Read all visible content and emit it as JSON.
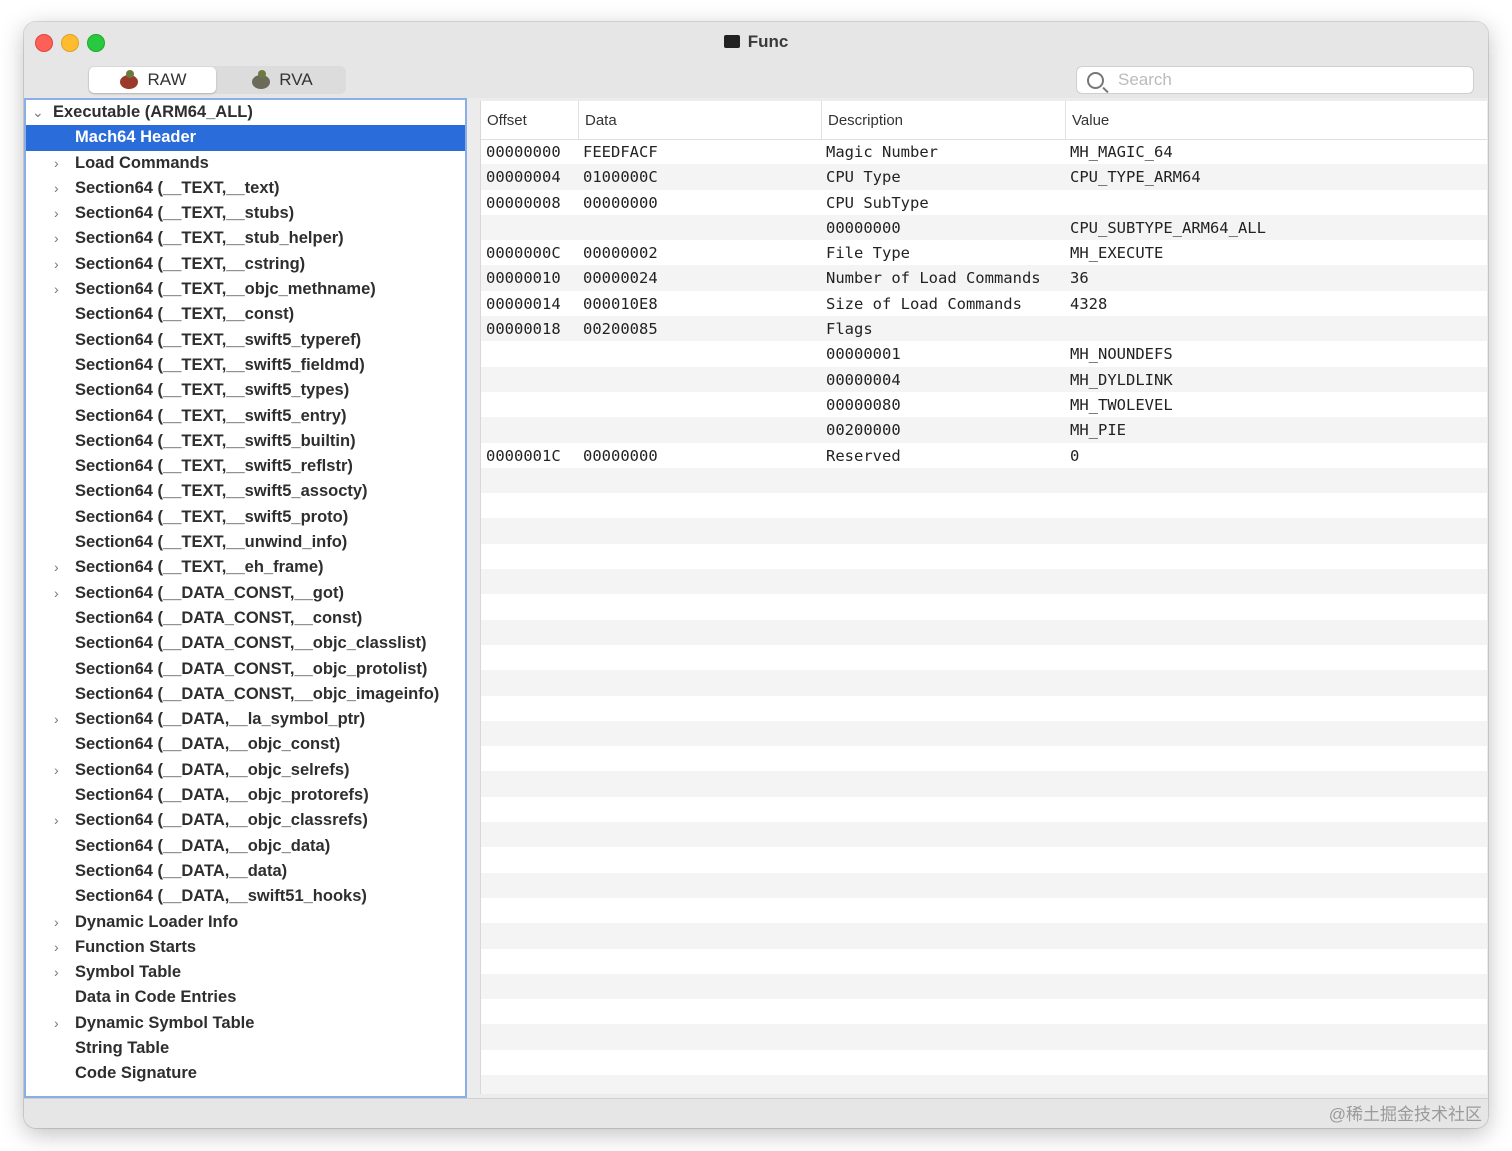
{
  "window": {
    "title": "Func"
  },
  "toolbar": {
    "segments": [
      {
        "label": "RAW",
        "active": true
      },
      {
        "label": "RVA",
        "active": false
      }
    ],
    "search_placeholder": "Search"
  },
  "sidebar": {
    "root": "Executable  (ARM64_ALL)",
    "items": [
      {
        "label": "Mach64 Header",
        "expandable": false,
        "selected": true
      },
      {
        "label": "Load Commands",
        "expandable": true
      },
      {
        "label": "Section64 (__TEXT,__text)",
        "expandable": true
      },
      {
        "label": "Section64 (__TEXT,__stubs)",
        "expandable": true
      },
      {
        "label": "Section64 (__TEXT,__stub_helper)",
        "expandable": true
      },
      {
        "label": "Section64 (__TEXT,__cstring)",
        "expandable": true
      },
      {
        "label": "Section64 (__TEXT,__objc_methname)",
        "expandable": true
      },
      {
        "label": "Section64 (__TEXT,__const)",
        "expandable": false
      },
      {
        "label": "Section64 (__TEXT,__swift5_typeref)",
        "expandable": false
      },
      {
        "label": "Section64 (__TEXT,__swift5_fieldmd)",
        "expandable": false
      },
      {
        "label": "Section64 (__TEXT,__swift5_types)",
        "expandable": false
      },
      {
        "label": "Section64 (__TEXT,__swift5_entry)",
        "expandable": false
      },
      {
        "label": "Section64 (__TEXT,__swift5_builtin)",
        "expandable": false
      },
      {
        "label": "Section64 (__TEXT,__swift5_reflstr)",
        "expandable": false
      },
      {
        "label": "Section64 (__TEXT,__swift5_assocty)",
        "expandable": false
      },
      {
        "label": "Section64 (__TEXT,__swift5_proto)",
        "expandable": false
      },
      {
        "label": "Section64 (__TEXT,__unwind_info)",
        "expandable": false
      },
      {
        "label": "Section64 (__TEXT,__eh_frame)",
        "expandable": true
      },
      {
        "label": "Section64 (__DATA_CONST,__got)",
        "expandable": true
      },
      {
        "label": "Section64 (__DATA_CONST,__const)",
        "expandable": false
      },
      {
        "label": "Section64 (__DATA_CONST,__objc_classlist)",
        "expandable": false
      },
      {
        "label": "Section64 (__DATA_CONST,__objc_protolist)",
        "expandable": false
      },
      {
        "label": "Section64 (__DATA_CONST,__objc_imageinfo)",
        "expandable": false
      },
      {
        "label": "Section64 (__DATA,__la_symbol_ptr)",
        "expandable": true
      },
      {
        "label": "Section64 (__DATA,__objc_const)",
        "expandable": false
      },
      {
        "label": "Section64 (__DATA,__objc_selrefs)",
        "expandable": true
      },
      {
        "label": "Section64 (__DATA,__objc_protorefs)",
        "expandable": false
      },
      {
        "label": "Section64 (__DATA,__objc_classrefs)",
        "expandable": true
      },
      {
        "label": "Section64 (__DATA,__objc_data)",
        "expandable": false
      },
      {
        "label": "Section64 (__DATA,__data)",
        "expandable": false
      },
      {
        "label": "Section64 (__DATA,__swift51_hooks)",
        "expandable": false
      },
      {
        "label": "Dynamic Loader Info",
        "expandable": true
      },
      {
        "label": "Function Starts",
        "expandable": true
      },
      {
        "label": "Symbol Table",
        "expandable": true
      },
      {
        "label": "Data in Code Entries",
        "expandable": false
      },
      {
        "label": "Dynamic Symbol Table",
        "expandable": true
      },
      {
        "label": "String Table",
        "expandable": false
      },
      {
        "label": "Code Signature",
        "expandable": false
      }
    ]
  },
  "table": {
    "columns": [
      "Offset",
      "Data",
      "Description",
      "Value"
    ],
    "rows": [
      [
        "00000000",
        "FEEDFACF",
        "Magic Number",
        "MH_MAGIC_64"
      ],
      [
        "00000004",
        "0100000C",
        "CPU Type",
        "CPU_TYPE_ARM64"
      ],
      [
        "00000008",
        "00000000",
        "CPU SubType",
        ""
      ],
      [
        "",
        "",
        "00000000",
        "CPU_SUBTYPE_ARM64_ALL"
      ],
      [
        "0000000C",
        "00000002",
        "File Type",
        "MH_EXECUTE"
      ],
      [
        "00000010",
        "00000024",
        "Number of Load Commands",
        "36"
      ],
      [
        "00000014",
        "000010E8",
        "Size of Load Commands",
        "4328"
      ],
      [
        "00000018",
        "00200085",
        "Flags",
        ""
      ],
      [
        "",
        "",
        "00000001",
        "MH_NOUNDEFS"
      ],
      [
        "",
        "",
        "00000004",
        "MH_DYLDLINK"
      ],
      [
        "",
        "",
        "00000080",
        "MH_TWOLEVEL"
      ],
      [
        "",
        "",
        "00200000",
        "MH_PIE"
      ],
      [
        "0000001C",
        "00000000",
        "Reserved",
        "0"
      ]
    ]
  },
  "watermark": "@稀土掘金技术社区"
}
